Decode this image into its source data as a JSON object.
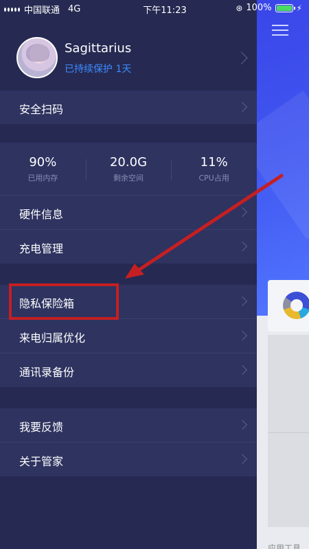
{
  "status_bar": {
    "carrier": "中国联通",
    "network": "4G",
    "time": "下午11:23",
    "battery_percent": "100%"
  },
  "profile": {
    "name": "Sagittarius",
    "protection_text": "已持续保护 1天"
  },
  "menu": {
    "scan_label": "安全扫码",
    "hardware_label": "硬件信息",
    "charging_label": "充电管理",
    "privacy_label": "隐私保险箱",
    "caller_label": "来电归属优化",
    "contacts_label": "通讯录备份",
    "feedback_label": "我要反馈",
    "about_label": "关于管家"
  },
  "stats": [
    {
      "value": "90%",
      "label": "已用内存"
    },
    {
      "value": "20.0G",
      "label": "剩余空间"
    },
    {
      "value": "11%",
      "label": "CPU占用"
    }
  ],
  "background": {
    "bottom_text": "应用工具"
  },
  "colors": {
    "drawer_bg": "#262a52",
    "row_bg": "#2e3360",
    "accent_blue": "#3d8bff",
    "annotation_red": "#c51f22"
  }
}
